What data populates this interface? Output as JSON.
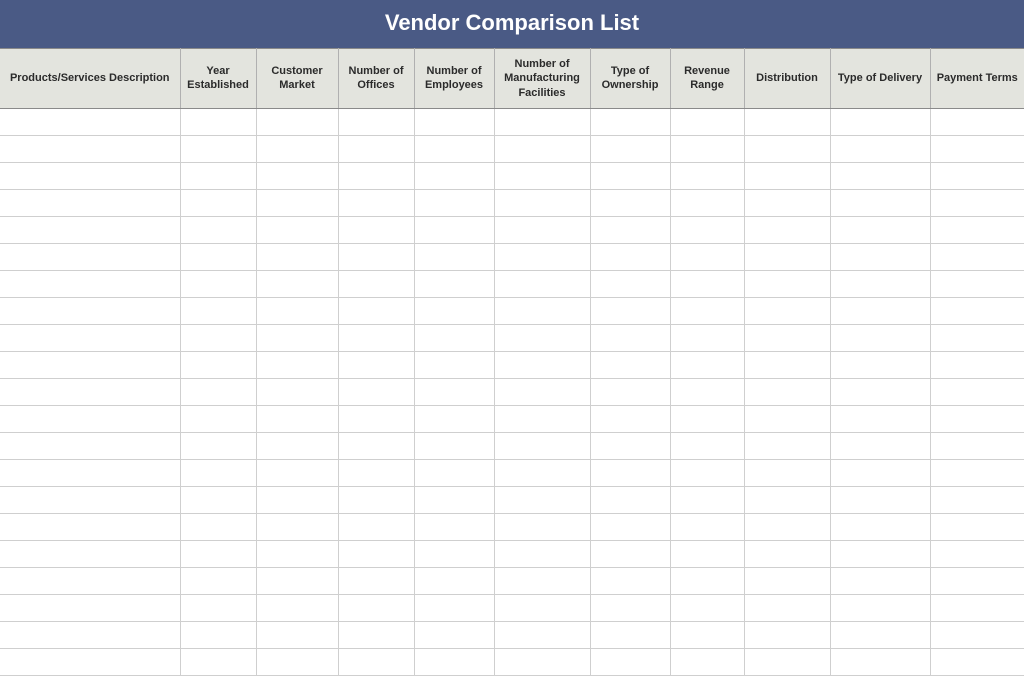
{
  "title": "Vendor Comparison List",
  "columns": [
    "Products/Services Description",
    "Year Established",
    "Customer Market",
    "Number of Offices",
    "Number of Employees",
    "Number of Manufacturing Facilities",
    "Type of Ownership",
    "Revenue Range",
    "Distribution",
    "Type of Delivery",
    "Payment Terms"
  ],
  "rows": [
    [
      "",
      "",
      "",
      "",
      "",
      "",
      "",
      "",
      "",
      "",
      ""
    ],
    [
      "",
      "",
      "",
      "",
      "",
      "",
      "",
      "",
      "",
      "",
      ""
    ],
    [
      "",
      "",
      "",
      "",
      "",
      "",
      "",
      "",
      "",
      "",
      ""
    ],
    [
      "",
      "",
      "",
      "",
      "",
      "",
      "",
      "",
      "",
      "",
      ""
    ],
    [
      "",
      "",
      "",
      "",
      "",
      "",
      "",
      "",
      "",
      "",
      ""
    ],
    [
      "",
      "",
      "",
      "",
      "",
      "",
      "",
      "",
      "",
      "",
      ""
    ],
    [
      "",
      "",
      "",
      "",
      "",
      "",
      "",
      "",
      "",
      "",
      ""
    ],
    [
      "",
      "",
      "",
      "",
      "",
      "",
      "",
      "",
      "",
      "",
      ""
    ],
    [
      "",
      "",
      "",
      "",
      "",
      "",
      "",
      "",
      "",
      "",
      ""
    ],
    [
      "",
      "",
      "",
      "",
      "",
      "",
      "",
      "",
      "",
      "",
      ""
    ],
    [
      "",
      "",
      "",
      "",
      "",
      "",
      "",
      "",
      "",
      "",
      ""
    ],
    [
      "",
      "",
      "",
      "",
      "",
      "",
      "",
      "",
      "",
      "",
      ""
    ],
    [
      "",
      "",
      "",
      "",
      "",
      "",
      "",
      "",
      "",
      "",
      ""
    ],
    [
      "",
      "",
      "",
      "",
      "",
      "",
      "",
      "",
      "",
      "",
      ""
    ],
    [
      "",
      "",
      "",
      "",
      "",
      "",
      "",
      "",
      "",
      "",
      ""
    ],
    [
      "",
      "",
      "",
      "",
      "",
      "",
      "",
      "",
      "",
      "",
      ""
    ],
    [
      "",
      "",
      "",
      "",
      "",
      "",
      "",
      "",
      "",
      "",
      ""
    ],
    [
      "",
      "",
      "",
      "",
      "",
      "",
      "",
      "",
      "",
      "",
      ""
    ],
    [
      "",
      "",
      "",
      "",
      "",
      "",
      "",
      "",
      "",
      "",
      ""
    ],
    [
      "",
      "",
      "",
      "",
      "",
      "",
      "",
      "",
      "",
      "",
      ""
    ],
    [
      "",
      "",
      "",
      "",
      "",
      "",
      "",
      "",
      "",
      "",
      ""
    ]
  ]
}
